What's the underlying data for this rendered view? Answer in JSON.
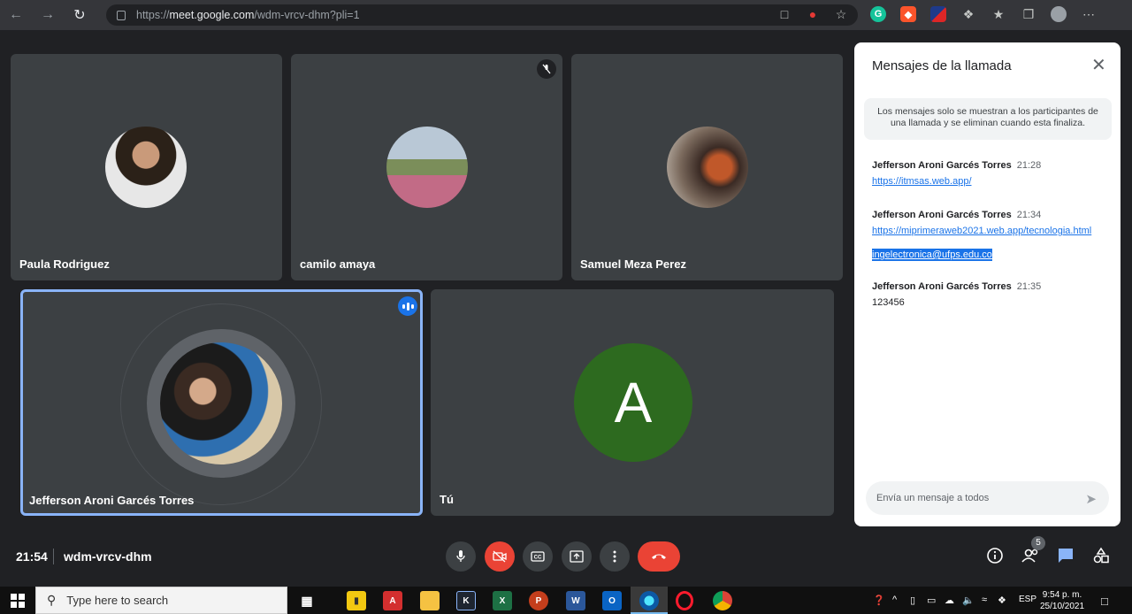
{
  "browser": {
    "url_prefix": "https://",
    "url_host": "meet.google.com",
    "url_path": "/wdm-vrcv-dhm?pli=1"
  },
  "participants": [
    {
      "name": "Paula Rodriguez"
    },
    {
      "name": "camilo amaya",
      "muted": true
    },
    {
      "name": "Samuel Meza Perez"
    },
    {
      "name": "Jefferson Aroni Garcés Torres",
      "speaking": true
    },
    {
      "name": "Tú",
      "initial": "A"
    }
  ],
  "chat": {
    "title": "Mensajes de la llamada",
    "notice": "Los mensajes solo se muestran a los participantes de una llamada y se eliminan cuando esta finaliza.",
    "messages": [
      {
        "sender": "Jefferson Aroni Garcés Torres",
        "time": "21:28",
        "lines": [
          "https://itmsas.web.app/"
        ]
      },
      {
        "sender": "Jefferson Aroni Garcés Torres",
        "time": "21:34",
        "lines": [
          "https://miprimeraweb2021.web.app/tecnologia.html",
          "ingelectronica@ufps.edu.co"
        ]
      },
      {
        "sender": "Jefferson Aroni Garcés Torres",
        "time": "21:35",
        "lines": [
          "123456"
        ]
      }
    ],
    "input_placeholder": "Envía un mensaje a todos"
  },
  "bottom_bar": {
    "time": "21:54",
    "meeting_code": "wdm-vrcv-dhm",
    "participants_count": "5"
  },
  "taskbar": {
    "search_placeholder": "Type here to search",
    "language": "ESP",
    "clock_time": "9:54 p. m.",
    "clock_date": "25/10/2021"
  },
  "colors": {
    "meet_bg": "#202124",
    "tile_bg": "#3c4043",
    "accent_blue": "#1a73e8",
    "hangup_red": "#ea4335",
    "avatar_green": "#2d6a1f"
  }
}
